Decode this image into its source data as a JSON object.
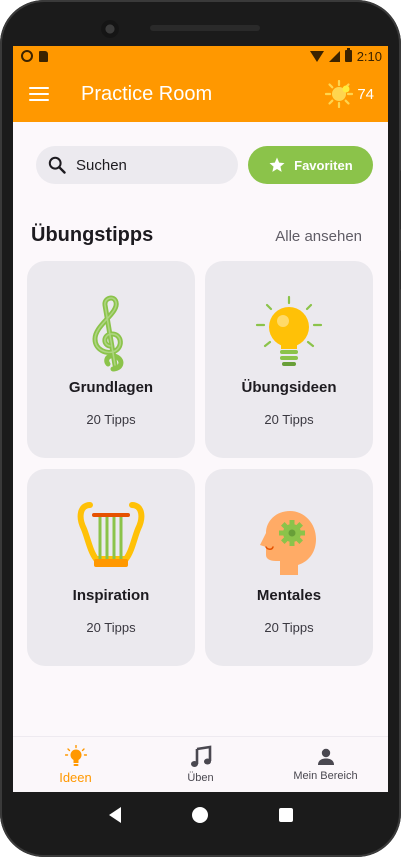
{
  "status_bar": {
    "time": "2:10"
  },
  "app_bar": {
    "title": "Practice Room",
    "score": "74"
  },
  "search": {
    "placeholder": "Suchen"
  },
  "favorites": {
    "label": "Favoriten"
  },
  "section": {
    "title": "Übungstipps",
    "see_all": "Alle ansehen"
  },
  "cards": [
    {
      "title": "Grundlagen",
      "count": "20 Tipps",
      "icon": "treble-clef-icon"
    },
    {
      "title": "Übungsideen",
      "count": "20 Tipps",
      "icon": "lightbulb-icon"
    },
    {
      "title": "Inspiration",
      "count": "20 Tipps",
      "icon": "lyre-icon"
    },
    {
      "title": "Mentales",
      "count": "20 Tipps",
      "icon": "mind-gear-icon"
    }
  ],
  "bottom_nav": [
    {
      "label": "Ideen",
      "icon": "lightbulb-icon",
      "active": true
    },
    {
      "label": "Üben",
      "icon": "music-note-icon",
      "active": false
    },
    {
      "label": "Mein Bereich",
      "icon": "person-icon",
      "active": false
    }
  ],
  "colors": {
    "accent": "#ff9800",
    "favorite": "#8bc34a",
    "card": "#ebe9ee"
  }
}
